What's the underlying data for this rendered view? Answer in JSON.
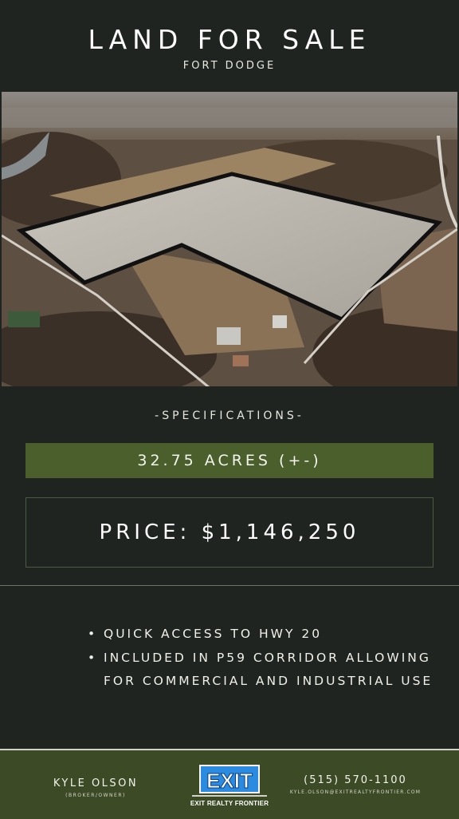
{
  "header": {
    "title": "LAND FOR SALE",
    "subtitle": "FORT DODGE"
  },
  "specifications": {
    "label": "-SPECIFICATIONS-",
    "acres": "32.75 ACRES (+-)",
    "price": "PRICE: $1,146,250"
  },
  "features": [
    {
      "bullet": "•",
      "text": "QUICK ACCESS TO HWY 20"
    },
    {
      "bullet": "•",
      "text": "INCLUDED IN P59 CORRIDOR ALLOWING FOR COMMERCIAL AND INDUSTRIAL USE"
    }
  ],
  "footer": {
    "agent_name": "KYLE OLSON",
    "agent_role": "(BROKER/OWNER)",
    "logo_text": "EXIT",
    "brand": "EXIT REALTY FRONTIER",
    "phone": "(515) 570-1100",
    "email": "KYLE.OLSON@EXITREALTYFRONTIER.COM"
  },
  "colors": {
    "background": "#1f2420",
    "accent_green": "#4a5f2c",
    "footer_green": "#3c4b26",
    "logo_blue": "#2a8be0"
  }
}
